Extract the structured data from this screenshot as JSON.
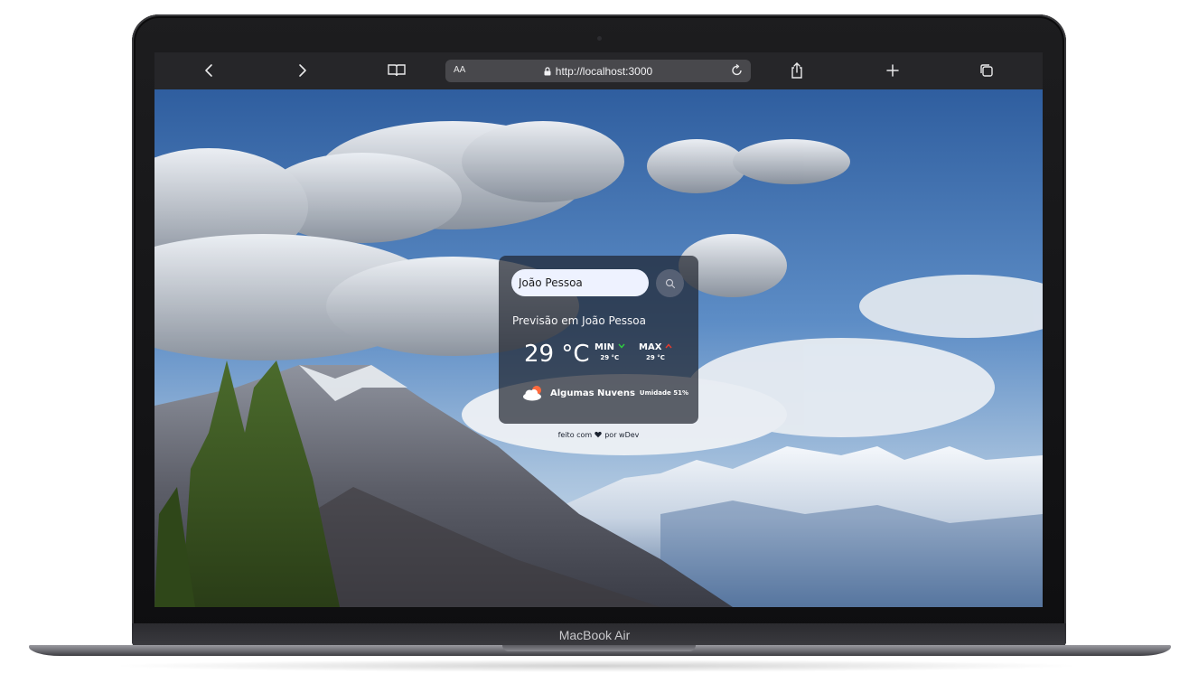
{
  "device": {
    "brand_label": "MacBook Air"
  },
  "browser": {
    "text_size_label": "AA",
    "url": "http://localhost:3000",
    "icons": [
      "back-chevron-icon",
      "forward-chevron-icon",
      "bookmarks-book-icon",
      "lock-icon",
      "reload-icon",
      "share-icon",
      "new-tab-plus-icon",
      "tabs-overview-icon"
    ]
  },
  "weather": {
    "search_value": "João Pessoa",
    "forecast_title": "Previsão em João Pessoa",
    "temperature": "29 °C",
    "min_label": "MIN",
    "min_value": "29 °C",
    "max_label": "MAX",
    "max_value": "29 °C",
    "condition": "Algumas Nuvens",
    "humidity": "Umidade 51%",
    "colors": {
      "min_arrow": "#2ecc40",
      "max_arrow": "#e63b2e",
      "card_bg": "#1e222c"
    }
  },
  "credit": {
    "prefix": "feito com",
    "suffix": "por wDev"
  }
}
